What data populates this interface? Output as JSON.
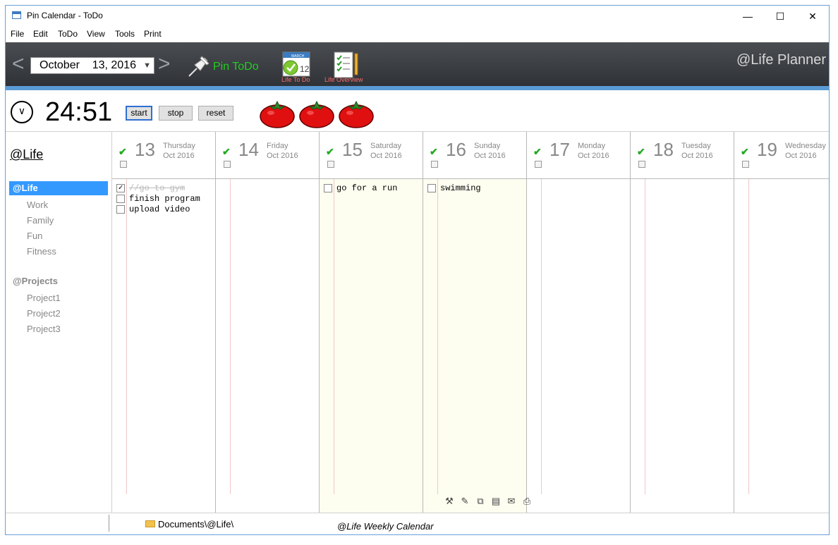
{
  "window": {
    "title": "Pin Calendar - ToDo",
    "minimize": "—",
    "maximize": "☐",
    "close": "✕"
  },
  "menu": [
    "File",
    "Edit",
    "ToDo",
    "View",
    "Tools",
    "Print"
  ],
  "toolbar": {
    "prev": "<",
    "next": ">",
    "date_value": "October    13, 2016",
    "pin_label": "Pin ToDo",
    "life_todo_label": "Life To Do",
    "life_overview_label": "Life Overview",
    "brand": "@Life Planner",
    "calendar_icon_text": "12",
    "calendar_icon_month": "MARCH"
  },
  "timer": {
    "value": "24:51",
    "start": "start",
    "stop": "stop",
    "reset": "reset",
    "tomatoes": 3
  },
  "sidebar": {
    "title": "@Life",
    "items": [
      {
        "label": "@Life",
        "kind": "selected"
      },
      {
        "label": "Work",
        "kind": "sub"
      },
      {
        "label": "Family",
        "kind": "sub"
      },
      {
        "label": "Fun",
        "kind": "sub"
      },
      {
        "label": "Fitness",
        "kind": "sub"
      },
      {
        "label": "@Projects",
        "kind": "group"
      },
      {
        "label": "Project1",
        "kind": "sub"
      },
      {
        "label": "Project2",
        "kind": "sub"
      },
      {
        "label": "Project3",
        "kind": "sub"
      }
    ]
  },
  "days": [
    {
      "num": "13",
      "name": "Thursday",
      "month": "Oct 2016",
      "weekend": false,
      "tasks": [
        {
          "text": "//go to gym",
          "done": true
        },
        {
          "text": "finish program",
          "done": false
        },
        {
          "text": "upload video",
          "done": false
        }
      ]
    },
    {
      "num": "14",
      "name": "Friday",
      "month": "Oct 2016",
      "weekend": false,
      "tasks": []
    },
    {
      "num": "15",
      "name": "Saturday",
      "month": "Oct 2016",
      "weekend": true,
      "tasks": [
        {
          "text": "go for a run",
          "done": false
        }
      ]
    },
    {
      "num": "16",
      "name": "Sunday",
      "month": "Oct 2016",
      "weekend": true,
      "tasks": [
        {
          "text": "swimming",
          "done": false
        }
      ]
    },
    {
      "num": "17",
      "name": "Monday",
      "month": "Oct 2016",
      "weekend": false,
      "tasks": []
    },
    {
      "num": "18",
      "name": "Tuesday",
      "month": "Oct 2016",
      "weekend": false,
      "tasks": []
    },
    {
      "num": "19",
      "name": "Wednesday",
      "month": "Oct 2016",
      "weekend": false,
      "tasks": []
    }
  ],
  "column_tools": [
    "tools-icon",
    "check-note-icon",
    "copy-icon",
    "paste-icon",
    "mail-icon",
    "print-icon"
  ],
  "status": {
    "path": "Documents\\@Life\\",
    "label": "@Life Weekly Calendar"
  },
  "colors": {
    "accent": "#3399ff",
    "pin_green": "#22cc22",
    "weekend_bg": "#fdfdf0",
    "toolbar_bg": "#3a3d42"
  }
}
